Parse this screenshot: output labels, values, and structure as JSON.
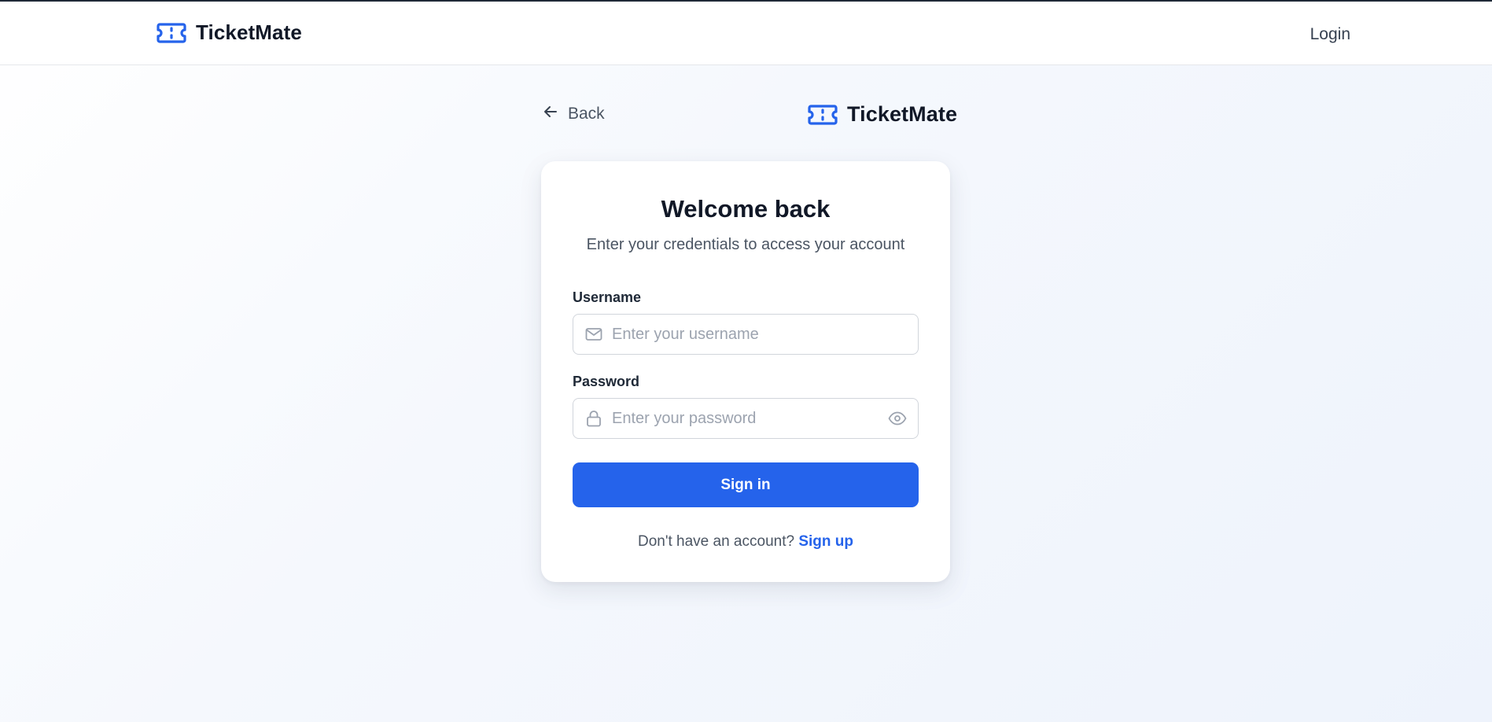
{
  "navbar": {
    "brand_name": "TicketMate",
    "brand_icon": "ticket-icon",
    "login_label": "Login"
  },
  "page": {
    "back_label": "Back",
    "back_icon": "arrow-left-icon",
    "brand_name": "TicketMate"
  },
  "card": {
    "title": "Welcome back",
    "subtitle": "Enter your credentials to access your account",
    "username": {
      "label": "Username",
      "placeholder": "Enter your username",
      "value": "",
      "icon": "mail-icon"
    },
    "password": {
      "label": "Password",
      "placeholder": "Enter your password",
      "value": "",
      "icon": "lock-icon",
      "toggle_icon": "eye-icon"
    },
    "submit_label": "Sign in",
    "signup_prompt": "Don't have an account?",
    "signup_link": "Sign up"
  },
  "colors": {
    "accent": "#2563eb",
    "text_primary": "#111827",
    "text_secondary": "#4b5563",
    "placeholder": "#9ca3af",
    "border": "#d1d5db"
  }
}
